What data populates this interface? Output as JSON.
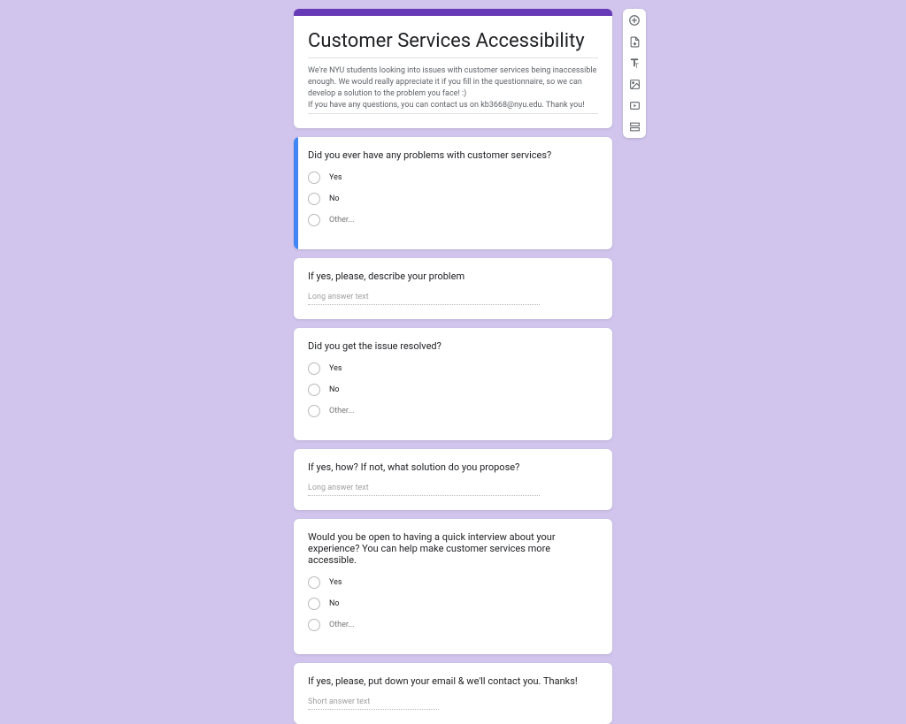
{
  "header": {
    "title": "Customer Services Accessibility",
    "description_l1": "We're NYU students looking into issues with customer services being inaccessible enough. We would really appreciate it if you fill in the questionnaire, so we can develop a solution to the problem you face! :)",
    "description_l2": "If you have any questions, you can contact us on kb3668@nyu.edu. Thank you!"
  },
  "q1": {
    "text": "Did you ever have any problems with customer services?",
    "opt1": "Yes",
    "opt2": "No",
    "opt3": "Other..."
  },
  "q2": {
    "text": "If yes, please, describe your problem",
    "placeholder": "Long answer text"
  },
  "q3": {
    "text": "Did you get the issue resolved?",
    "opt1": "Yes",
    "opt2": "No",
    "opt3": "Other..."
  },
  "q4": {
    "text": "If yes, how? If not, what solution do you propose?",
    "placeholder": "Long answer text"
  },
  "q5": {
    "text": "Would you be open to having a quick interview about your experience? You can help make customer services more accessible.",
    "opt1": "Yes",
    "opt2": "No",
    "opt3": "Other..."
  },
  "q6": {
    "text": "If yes, please, put down your email & we'll contact you. Thanks!",
    "placeholder": "Short answer text"
  }
}
